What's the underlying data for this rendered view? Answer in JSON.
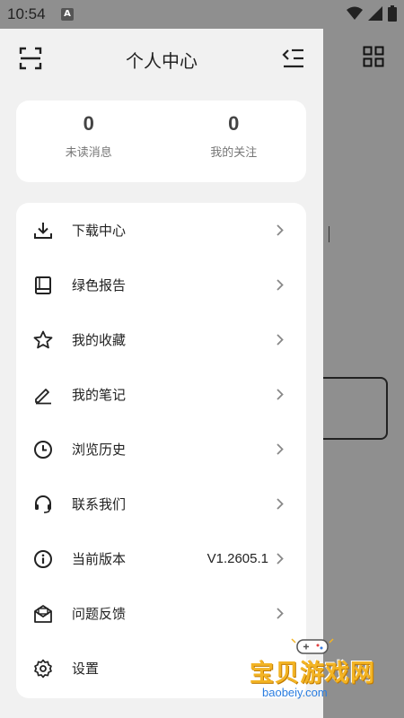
{
  "status_bar": {
    "time": "10:54",
    "notification_letter": "A"
  },
  "header": {
    "title": "个人中心"
  },
  "stats": [
    {
      "value": "0",
      "label": "未读消息"
    },
    {
      "value": "0",
      "label": "我的关注"
    }
  ],
  "menu": [
    {
      "label": "下载中心",
      "icon": "download-icon",
      "value": ""
    },
    {
      "label": "绿色报告",
      "icon": "book-icon",
      "value": ""
    },
    {
      "label": "我的收藏",
      "icon": "star-icon",
      "value": ""
    },
    {
      "label": "我的笔记",
      "icon": "pencil-icon",
      "value": ""
    },
    {
      "label": "浏览历史",
      "icon": "clock-icon",
      "value": ""
    },
    {
      "label": "联系我们",
      "icon": "headset-icon",
      "value": ""
    },
    {
      "label": "当前版本",
      "icon": "info-icon",
      "value": "V1.2605.1"
    },
    {
      "label": "问题反馈",
      "icon": "mail-icon",
      "value": ""
    },
    {
      "label": "设置",
      "icon": "gear-icon",
      "value": ""
    }
  ],
  "watermark": {
    "text": "宝贝游戏网",
    "url": "baobeiy.com"
  },
  "colors": {
    "drawer_bg": "#f1f1f1",
    "card_bg": "#ffffff",
    "scrim": "#8f8f8f",
    "watermark": "#f3b424"
  }
}
